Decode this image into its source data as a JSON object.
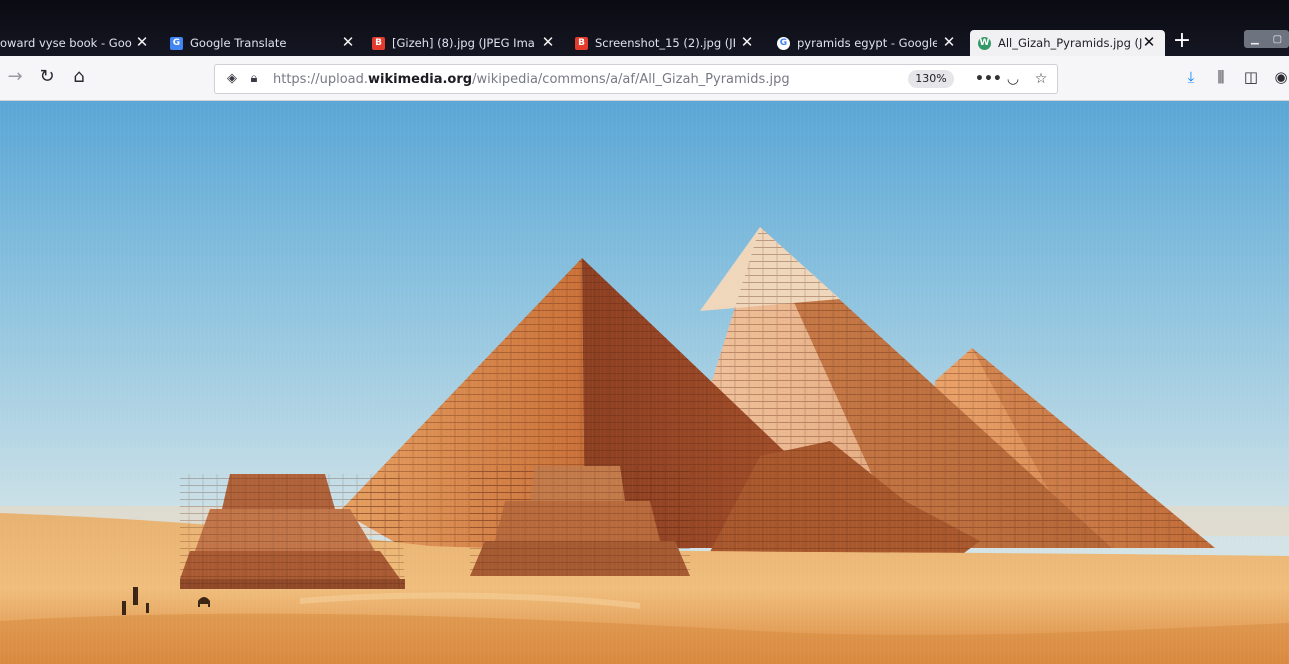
{
  "tabs": [
    {
      "title": "oward vyse book - Goo",
      "favicon": "google-icon"
    },
    {
      "title": "Google Translate",
      "favicon": "google-translate-icon"
    },
    {
      "title": "[Gizeh] (8).jpg (JPEG Ima",
      "favicon": "blogger-icon"
    },
    {
      "title": "Screenshot_15 (2).jpg (JF",
      "favicon": "blogger-icon"
    },
    {
      "title": "pyramids egypt - Google",
      "favicon": "google-icon"
    },
    {
      "title": "All_Gizah_Pyramids.jpg (J",
      "favicon": "wikimedia-icon",
      "active": true
    }
  ],
  "new_tab_symbol": "+",
  "address": {
    "prefix": "https://upload.",
    "host": "wikimedia.org",
    "path": "/wikipedia/commons/a/af/All_Gizah_Pyramids.jpg"
  },
  "zoom_level": "130%",
  "content": {
    "image_name": "All_Gizah_Pyramids.jpg"
  },
  "colors": {
    "accent": "#0a84ff",
    "favicon_blogger": "#e43b2c",
    "sky_top": "#58a9d8",
    "sand": "#e7a45a"
  }
}
